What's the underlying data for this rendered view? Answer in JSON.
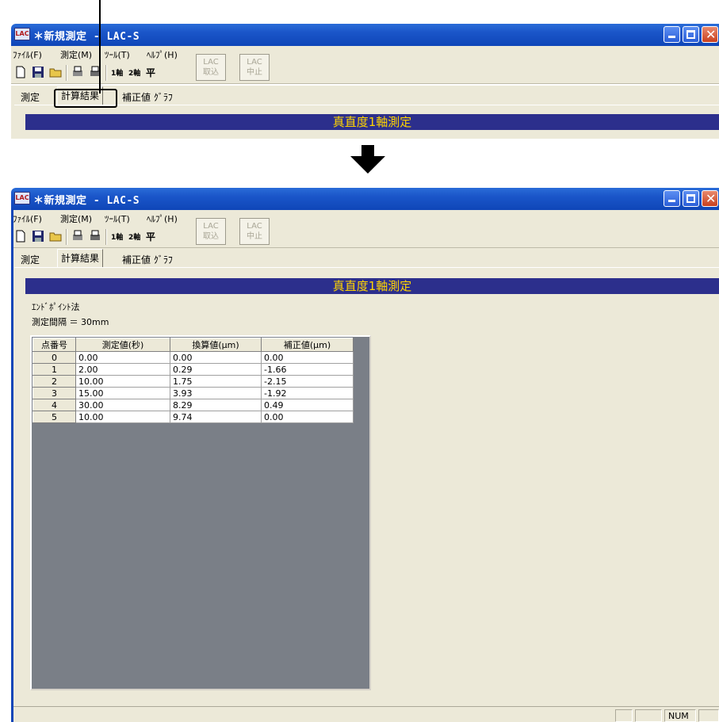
{
  "top": {
    "window": {
      "app_icon": "LAC",
      "title": "＊新規測定 - LAC-S"
    },
    "menu": [
      "ﾌｧｲﾙ(F)",
      "測定(M)",
      "ﾂｰﾙ(T)",
      "ﾍﾙﾌﾟ(H)"
    ],
    "toolbar": {
      "axis1": "1軸",
      "axis2": "2軸",
      "flat": "平",
      "lac_load_1": "LAC",
      "lac_load_2": "取込",
      "lac_stop_1": "LAC",
      "lac_stop_2": "中止"
    },
    "tabs": [
      "測定",
      "計算結果",
      "補正値 ｸﾞﾗﾌ"
    ],
    "banner": "真直度1軸測定"
  },
  "bottom": {
    "window": {
      "app_icon": "LAC",
      "title": "＊新規測定 - LAC-S"
    },
    "menu": [
      "ﾌｧｲﾙ(F)",
      "測定(M)",
      "ﾂｰﾙ(T)",
      "ﾍﾙﾌﾟ(H)"
    ],
    "toolbar": {
      "axis1": "1軸",
      "axis2": "2軸",
      "flat": "平",
      "lac_load_1": "LAC",
      "lac_load_2": "取込",
      "lac_stop_1": "LAC",
      "lac_stop_2": "中止"
    },
    "tabs": [
      "測定",
      "計算結果",
      "補正値 ｸﾞﾗﾌ"
    ],
    "banner": "真直度1軸測定",
    "method": "ｴﾝﾄﾞﾎﾟｲﾝﾄ法",
    "interval": "測定間隔 ＝ 30mm",
    "table": {
      "headers": [
        "点番号",
        "測定値(秒)",
        "換算値(μm)",
        "補正値(μm)"
      ],
      "rows": [
        [
          "0",
          "0.00",
          "0.00",
          "0.00"
        ],
        [
          "1",
          "2.00",
          "0.29",
          "-1.66"
        ],
        [
          "2",
          "10.00",
          "1.75",
          "-2.15"
        ],
        [
          "3",
          "15.00",
          "3.93",
          "-1.92"
        ],
        [
          "4",
          "30.00",
          "8.29",
          "0.49"
        ],
        [
          "5",
          "10.00",
          "9.74",
          "0.00"
        ]
      ]
    },
    "status": {
      "num": "NUM"
    }
  },
  "colors": {
    "titlebar": "#0f46b8",
    "banner_bg": "#2c2f8c",
    "banner_text": "#ffd400",
    "grid_bg": "#7a7f87"
  }
}
